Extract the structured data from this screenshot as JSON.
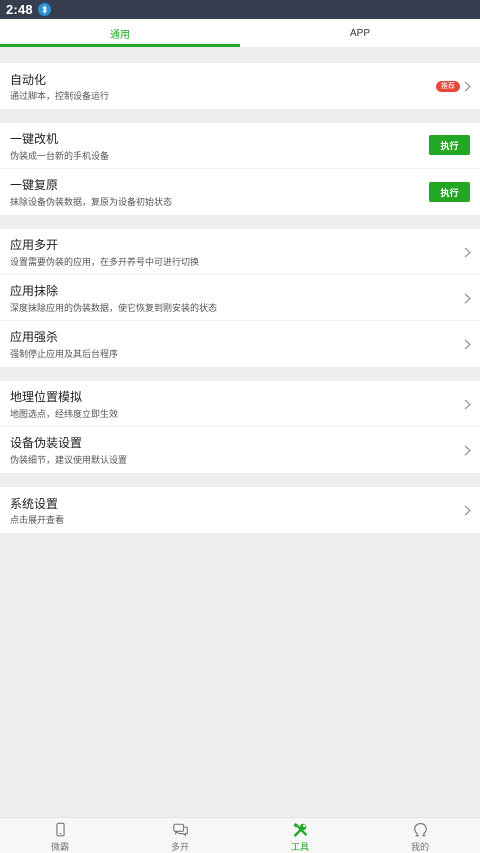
{
  "status_bar": {
    "time": "2:48",
    "bluetooth_icon": "bluetooth-icon"
  },
  "tabs": [
    {
      "label": "通用",
      "active": true
    },
    {
      "label": "APP",
      "active": false
    }
  ],
  "groups": [
    {
      "items": [
        {
          "title": "自动化",
          "subtitle": "通过脚本，控制设备运行",
          "badge": "推荐",
          "action": "chevron"
        }
      ]
    },
    {
      "items": [
        {
          "title": "一键改机",
          "subtitle": "伪装成一台新的手机设备",
          "button": "执行"
        },
        {
          "title": "一键复原",
          "subtitle": "抹除设备伪装数据，复原为设备初始状态",
          "button": "执行"
        }
      ]
    },
    {
      "items": [
        {
          "title": "应用多开",
          "subtitle": "设置需要伪装的应用，在多开养号中可进行切换",
          "action": "chevron"
        },
        {
          "title": "应用抹除",
          "subtitle": "深度抹除应用的伪装数据，使它恢复到刚安装的状态",
          "action": "chevron"
        },
        {
          "title": "应用强杀",
          "subtitle": "强制停止应用及其后台程序",
          "action": "chevron"
        }
      ]
    },
    {
      "items": [
        {
          "title": "地理位置模拟",
          "subtitle": "地图选点，经纬度立即生效",
          "action": "chevron"
        },
        {
          "title": "设备伪装设置",
          "subtitle": "伪装细节，建议使用默认设置",
          "action": "chevron"
        }
      ]
    },
    {
      "items": [
        {
          "title": "系统设置",
          "subtitle": "点击展开查看",
          "action": "chevron"
        }
      ]
    }
  ],
  "bottom_nav": [
    {
      "label": "微霸",
      "icon": "phone-icon",
      "active": false
    },
    {
      "label": "多开",
      "icon": "chat-bubbles-icon",
      "active": false
    },
    {
      "label": "工具",
      "icon": "tools-icon",
      "active": true
    },
    {
      "label": "我的",
      "icon": "profile-icon",
      "active": false
    }
  ],
  "colors": {
    "accent": "#22a822",
    "badge": "#e8483b",
    "status_bar": "#353d4e",
    "background": "#eeeef0"
  }
}
